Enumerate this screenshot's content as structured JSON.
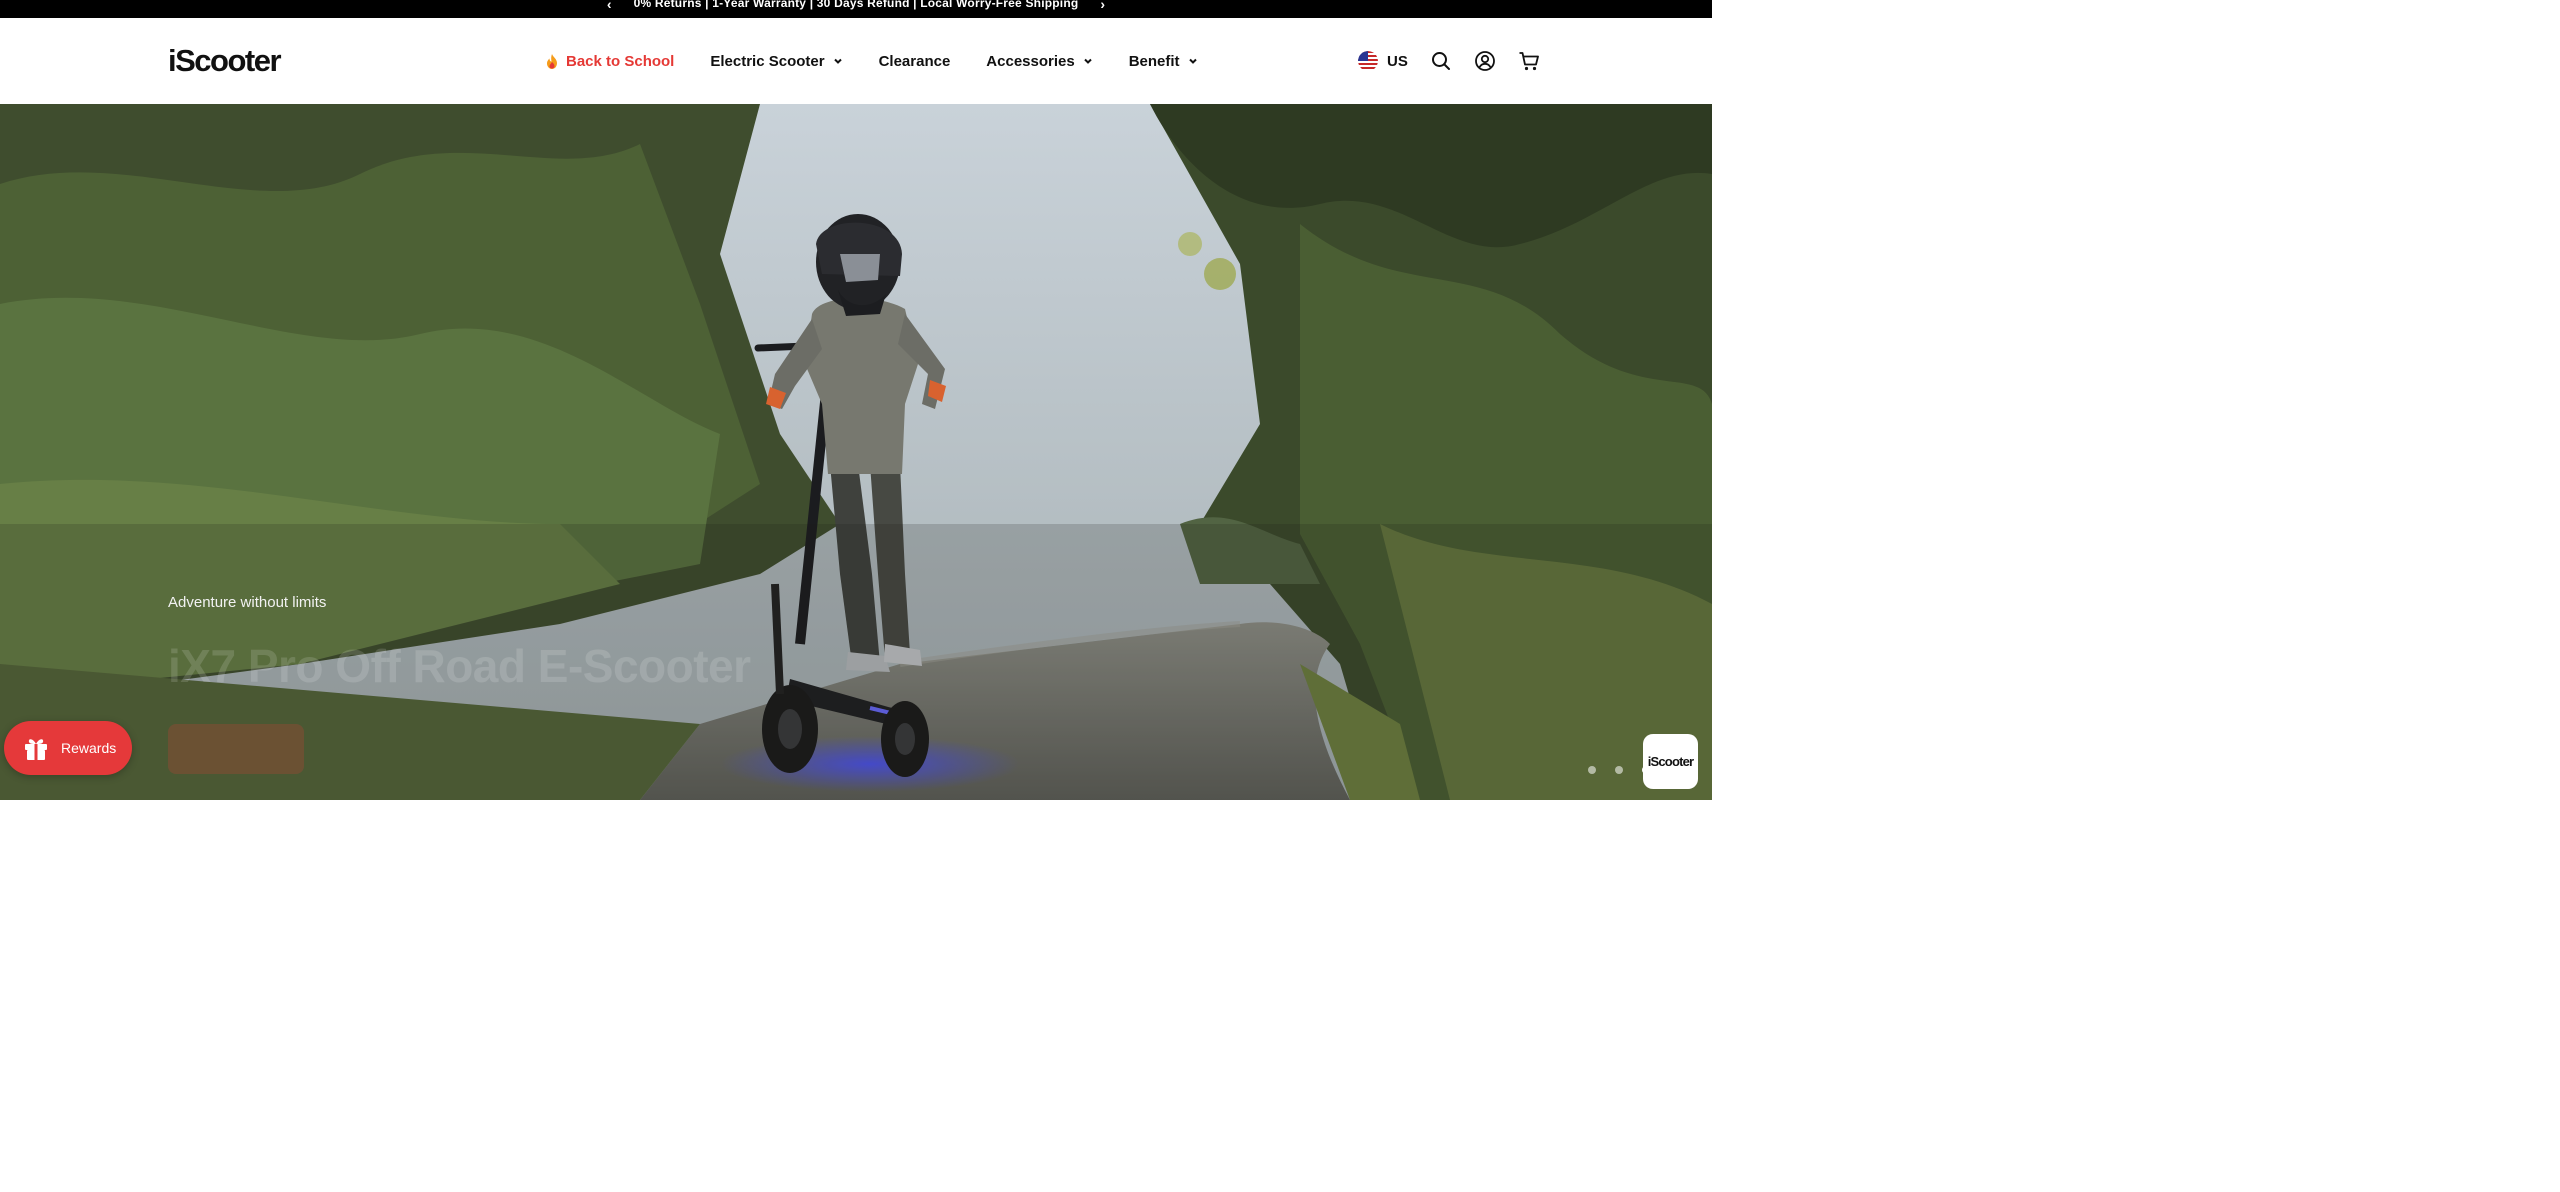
{
  "announcement": {
    "prev_label": "‹",
    "message": "0% Returns | 1-Year Warranty | 30 Days Refund | Local Worry-Free Shipping",
    "next_label": "›"
  },
  "header": {
    "logo": "iScooter",
    "nav": [
      {
        "label": "Back to School",
        "icon": "flame-icon",
        "color": "#e53935"
      },
      {
        "label": "Electric Scooter",
        "has_dropdown": true
      },
      {
        "label": "Clearance"
      },
      {
        "label": "Accessories",
        "has_dropdown": true
      },
      {
        "label": "Benefit",
        "has_dropdown": true
      }
    ],
    "locale": {
      "flag": "us-flag-icon",
      "label": "US"
    },
    "tools": [
      "search-icon",
      "account-icon",
      "cart-icon"
    ]
  },
  "hero": {
    "eyebrow": "Adventure without limits",
    "title": "iX7 Pro Off Road E-Scooter",
    "slides": 3,
    "active_slide": 3,
    "badge": "iScooter"
  },
  "rewards": {
    "label": "Rewards",
    "icon": "gift-icon",
    "color": "#e5393a"
  },
  "colors": {
    "accent": "#e53935",
    "topbar": "#000000"
  }
}
